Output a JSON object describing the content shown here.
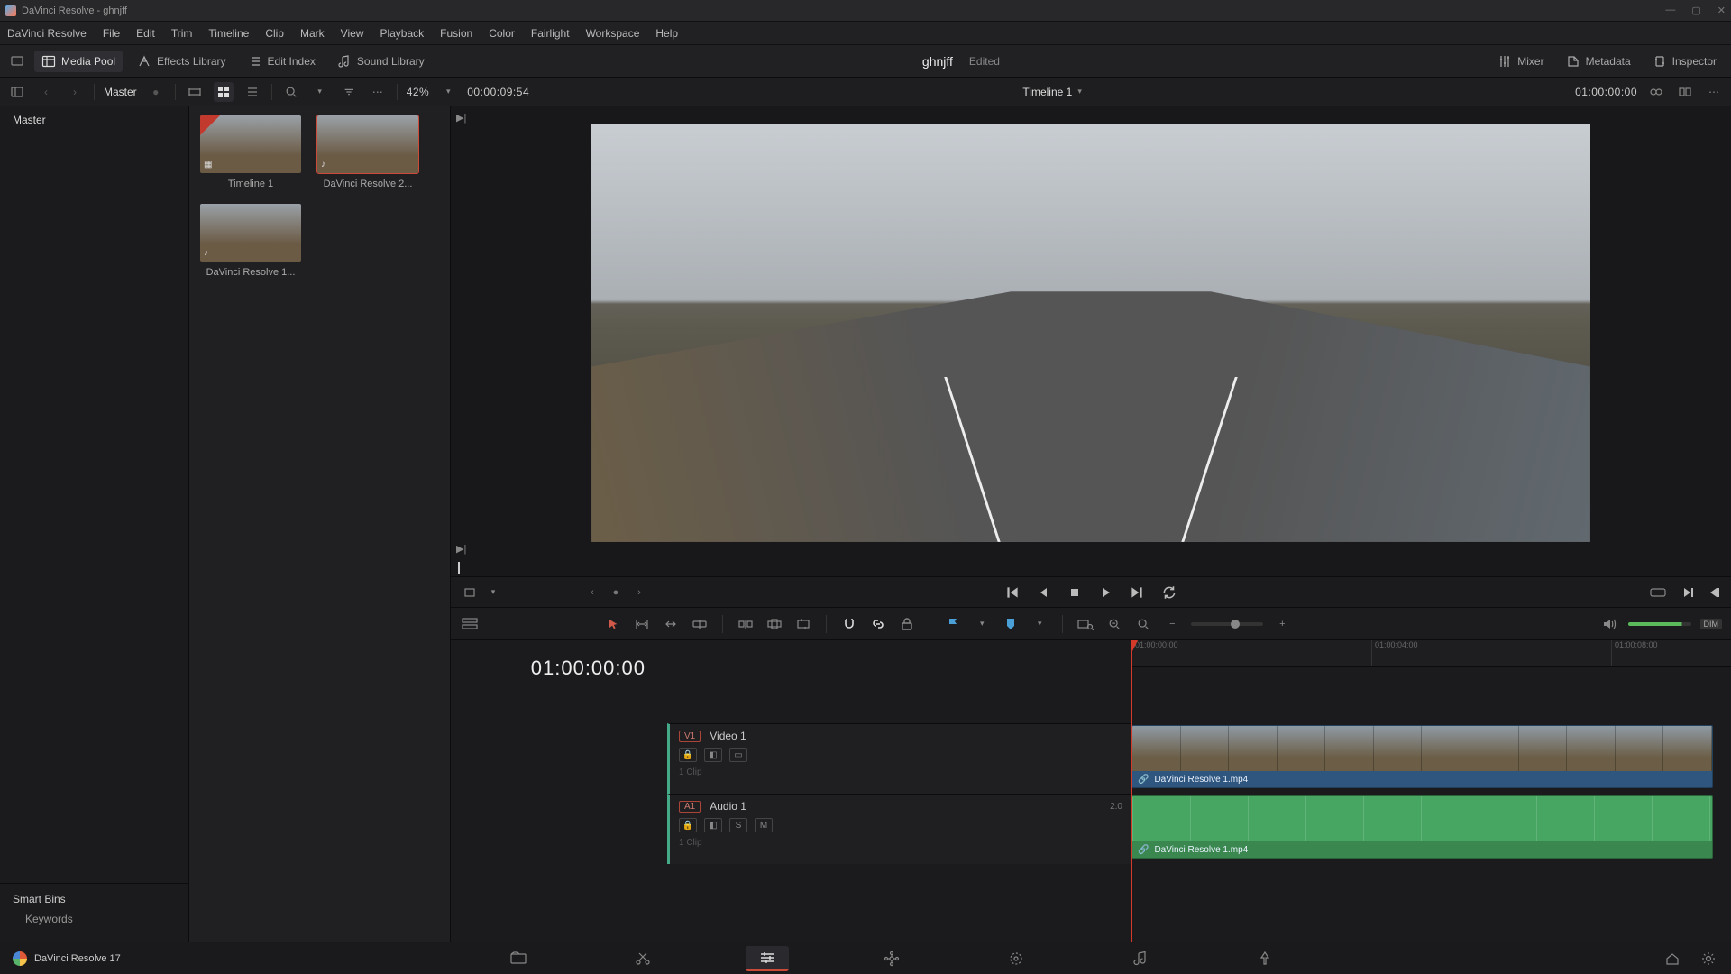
{
  "window": {
    "title": "DaVinci Resolve - ghnjff"
  },
  "menu": [
    "DaVinci Resolve",
    "File",
    "Edit",
    "Trim",
    "Timeline",
    "Clip",
    "Mark",
    "View",
    "Playback",
    "Fusion",
    "Color",
    "Fairlight",
    "Workspace",
    "Help"
  ],
  "toolbar": {
    "media_pool": "Media Pool",
    "effects_library": "Effects Library",
    "edit_index": "Edit Index",
    "sound_library": "Sound Library",
    "project_name": "ghnjff",
    "project_state": "Edited",
    "mixer": "Mixer",
    "metadata": "Metadata",
    "inspector": "Inspector"
  },
  "subbar": {
    "bin": "Master",
    "zoom": "42%",
    "src_tc": "00:00:09:54",
    "timeline_name": "Timeline 1",
    "rec_tc": "01:00:00:00"
  },
  "bins": {
    "master": "Master"
  },
  "smart_bins": {
    "title": "Smart Bins",
    "keywords": "Keywords"
  },
  "media": [
    {
      "label": "Timeline 1",
      "is_timeline": true,
      "has_audio": false
    },
    {
      "label": "DaVinci Resolve 2...",
      "is_timeline": false,
      "has_audio": true,
      "selected": true
    },
    {
      "label": "DaVinci Resolve 1...",
      "is_timeline": false,
      "has_audio": true
    }
  ],
  "timeline": {
    "display_tc": "01:00:00:00",
    "ruler": [
      "01:00:00:00",
      "01:00:04:00",
      "01:00:08:00"
    ],
    "video_track": {
      "tag": "V1",
      "name": "Video 1",
      "sub": "1 Clip",
      "clip_name": "DaVinci Resolve 1.mp4"
    },
    "audio_track": {
      "tag": "A1",
      "name": "Audio 1",
      "level": "2.0",
      "sub": "1 Clip",
      "clip_name": "DaVinci Resolve 1.mp4",
      "solo": "S",
      "mute": "M"
    }
  },
  "tltoolbar": {
    "dim": "DIM"
  },
  "pages": {
    "brand": "DaVinci Resolve 17"
  }
}
